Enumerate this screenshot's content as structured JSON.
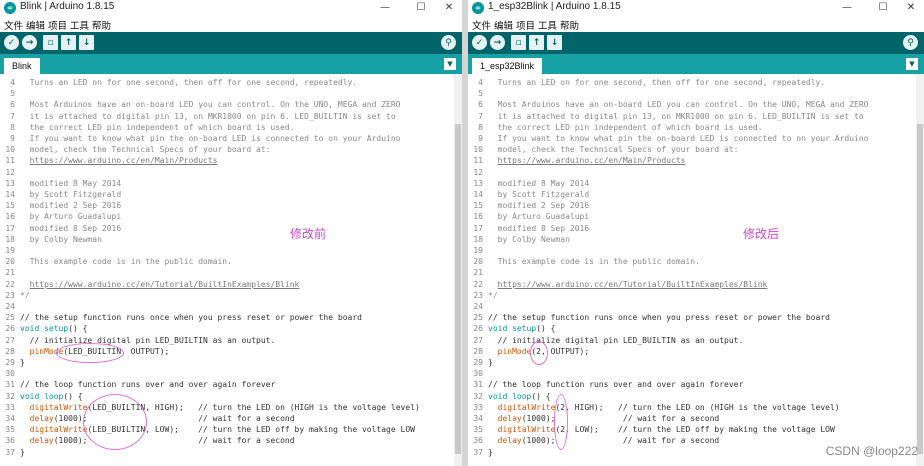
{
  "left": {
    "title": "Blink | Arduino 1.8.15",
    "tab": "Blink",
    "annotation": "修改前",
    "lines": [
      {
        "n": "4",
        "parts": [
          {
            "t": "  Turns an LED on for one second, then off for one second, repeatedly.",
            "c": "cm"
          }
        ]
      },
      {
        "n": "5",
        "parts": []
      },
      {
        "n": "6",
        "parts": [
          {
            "t": "  Most Arduinos have an on-board LED you can control. On the UNO, MEGA and ZERO",
            "c": "cm"
          }
        ]
      },
      {
        "n": "7",
        "parts": [
          {
            "t": "  it is attached to digital pin 13, on MKR1000 on pin 6. LED_BUILTIN is set to",
            "c": "cm"
          }
        ]
      },
      {
        "n": "8",
        "parts": [
          {
            "t": "  the correct LED pin independent of which board is used.",
            "c": "cm"
          }
        ]
      },
      {
        "n": "9",
        "parts": [
          {
            "t": "  If you want to know what pin the on-board LED is connected to on your Arduino",
            "c": "cm"
          }
        ]
      },
      {
        "n": "10",
        "parts": [
          {
            "t": "  model, check the Technical Specs of your board at:",
            "c": "cm"
          }
        ]
      },
      {
        "n": "11",
        "parts": [
          {
            "t": "  ",
            "c": "cm"
          },
          {
            "t": "https://www.arduino.cc/en/Main/Products",
            "c": "lk"
          }
        ]
      },
      {
        "n": "12",
        "parts": []
      },
      {
        "n": "13",
        "parts": [
          {
            "t": "  modified 8 May 2014",
            "c": "cm"
          }
        ]
      },
      {
        "n": "14",
        "parts": [
          {
            "t": "  by Scott Fitzgerald",
            "c": "cm"
          }
        ]
      },
      {
        "n": "15",
        "parts": [
          {
            "t": "  modified 2 Sep 2016",
            "c": "cm"
          }
        ]
      },
      {
        "n": "16",
        "parts": [
          {
            "t": "  by Arturo Guadalupi",
            "c": "cm"
          }
        ]
      },
      {
        "n": "17",
        "parts": [
          {
            "t": "  modified 8 Sep 2016",
            "c": "cm"
          }
        ]
      },
      {
        "n": "18",
        "parts": [
          {
            "t": "  by Colby Newman",
            "c": "cm"
          }
        ]
      },
      {
        "n": "19",
        "parts": []
      },
      {
        "n": "20",
        "parts": [
          {
            "t": "  This example code is in the public domain.",
            "c": "cm"
          }
        ]
      },
      {
        "n": "21",
        "parts": []
      },
      {
        "n": "22",
        "parts": [
          {
            "t": "  ",
            "c": "cm"
          },
          {
            "t": "https://www.arduino.cc/en/Tutorial/BuiltInExamples/Blink",
            "c": "lk"
          }
        ]
      },
      {
        "n": "23",
        "parts": [
          {
            "t": "*/",
            "c": "cm"
          }
        ]
      },
      {
        "n": "24",
        "parts": []
      },
      {
        "n": "25",
        "parts": [
          {
            "t": "// the setup function runs once when you press reset or power the board",
            "c": "tx"
          }
        ]
      },
      {
        "n": "26",
        "parts": [
          {
            "t": "void",
            "c": "kw"
          },
          {
            "t": " ",
            "c": "tx"
          },
          {
            "t": "setup",
            "c": "kw"
          },
          {
            "t": "() {",
            "c": "tx"
          }
        ]
      },
      {
        "n": "27",
        "parts": [
          {
            "t": "  // initialize digital pin LED_BUILTIN as an output.",
            "c": "tx"
          }
        ]
      },
      {
        "n": "28",
        "parts": [
          {
            "t": "  ",
            "c": "tx"
          },
          {
            "t": "pinMode",
            "c": "fn"
          },
          {
            "t": "(LED_BUILTIN, OUTPUT);",
            "c": "tx"
          }
        ]
      },
      {
        "n": "29",
        "parts": [
          {
            "t": "}",
            "c": "tx"
          }
        ]
      },
      {
        "n": "30",
        "parts": []
      },
      {
        "n": "31",
        "parts": [
          {
            "t": "// the loop function runs over and over again forever",
            "c": "tx"
          }
        ]
      },
      {
        "n": "32",
        "parts": [
          {
            "t": "void",
            "c": "kw"
          },
          {
            "t": " ",
            "c": "tx"
          },
          {
            "t": "loop",
            "c": "kw"
          },
          {
            "t": "() {",
            "c": "tx"
          }
        ]
      },
      {
        "n": "33",
        "parts": [
          {
            "t": "  ",
            "c": "tx"
          },
          {
            "t": "digitalWrite",
            "c": "fn"
          },
          {
            "t": "(LED_BUILTIN, HIGH);   // turn the LED on (HIGH is the voltage level)",
            "c": "tx"
          }
        ]
      },
      {
        "n": "34",
        "parts": [
          {
            "t": "  ",
            "c": "tx"
          },
          {
            "t": "delay",
            "c": "fn"
          },
          {
            "t": "(1000);                       // wait for a second",
            "c": "tx"
          }
        ]
      },
      {
        "n": "35",
        "parts": [
          {
            "t": "  ",
            "c": "tx"
          },
          {
            "t": "digitalWrite",
            "c": "fn"
          },
          {
            "t": "(LED_BUILTIN, LOW);    // turn the LED off by making the voltage LOW",
            "c": "tx"
          }
        ]
      },
      {
        "n": "36",
        "parts": [
          {
            "t": "  ",
            "c": "tx"
          },
          {
            "t": "delay",
            "c": "fn"
          },
          {
            "t": "(1000);                       // wait for a second",
            "c": "tx"
          }
        ]
      },
      {
        "n": "37",
        "parts": [
          {
            "t": "}",
            "c": "tx"
          }
        ]
      }
    ]
  },
  "right": {
    "title": "1_esp32Blink | Arduino 1.8.15",
    "tab": "1_esp32Blink",
    "annotation": "修改后",
    "lines": [
      {
        "n": "4",
        "parts": [
          {
            "t": "  Turns an LED on for one second, then off for one second, repeatedly.",
            "c": "cm"
          }
        ]
      },
      {
        "n": "5",
        "parts": []
      },
      {
        "n": "6",
        "parts": [
          {
            "t": "  Most Arduinos have an on-board LED you can control. On the UNO, MEGA and ZERO",
            "c": "cm"
          }
        ]
      },
      {
        "n": "7",
        "parts": [
          {
            "t": "  it is attached to digital pin 13, on MKR1000 on pin 6. LED_BUILTIN is set to",
            "c": "cm"
          }
        ]
      },
      {
        "n": "8",
        "parts": [
          {
            "t": "  the correct LED pin independent of which board is used.",
            "c": "cm"
          }
        ]
      },
      {
        "n": "9",
        "parts": [
          {
            "t": "  If you want to know what pin the on-board LED is connected to on your Arduino",
            "c": "cm"
          }
        ]
      },
      {
        "n": "10",
        "parts": [
          {
            "t": "  model, check the Technical Specs of your board at:",
            "c": "cm"
          }
        ]
      },
      {
        "n": "11",
        "parts": [
          {
            "t": "  ",
            "c": "cm"
          },
          {
            "t": "https://www.arduino.cc/en/Main/Products",
            "c": "lk"
          }
        ]
      },
      {
        "n": "12",
        "parts": []
      },
      {
        "n": "13",
        "parts": [
          {
            "t": "  modified 8 May 2014",
            "c": "cm"
          }
        ]
      },
      {
        "n": "14",
        "parts": [
          {
            "t": "  by Scott Fitzgerald",
            "c": "cm"
          }
        ]
      },
      {
        "n": "15",
        "parts": [
          {
            "t": "  modified 2 Sep 2016",
            "c": "cm"
          }
        ]
      },
      {
        "n": "16",
        "parts": [
          {
            "t": "  by Arturo Guadalupi",
            "c": "cm"
          }
        ]
      },
      {
        "n": "17",
        "parts": [
          {
            "t": "  modified 8 Sep 2016",
            "c": "cm"
          }
        ]
      },
      {
        "n": "18",
        "parts": [
          {
            "t": "  by Colby Newman",
            "c": "cm"
          }
        ]
      },
      {
        "n": "19",
        "parts": []
      },
      {
        "n": "20",
        "parts": [
          {
            "t": "  This example code is in the public domain.",
            "c": "cm"
          }
        ]
      },
      {
        "n": "21",
        "parts": []
      },
      {
        "n": "22",
        "parts": [
          {
            "t": "  ",
            "c": "cm"
          },
          {
            "t": "https://www.arduino.cc/en/Tutorial/BuiltInExamples/Blink",
            "c": "lk"
          }
        ]
      },
      {
        "n": "23",
        "parts": [
          {
            "t": "*/",
            "c": "cm"
          }
        ]
      },
      {
        "n": "24",
        "parts": []
      },
      {
        "n": "25",
        "parts": [
          {
            "t": "// the setup function runs once when you press reset or power the board",
            "c": "tx"
          }
        ]
      },
      {
        "n": "26",
        "parts": [
          {
            "t": "void",
            "c": "kw"
          },
          {
            "t": " ",
            "c": "tx"
          },
          {
            "t": "setup",
            "c": "kw"
          },
          {
            "t": "() {",
            "c": "tx"
          }
        ]
      },
      {
        "n": "27",
        "parts": [
          {
            "t": "  // initialize digital pin LED_BUILTIN as an output.",
            "c": "tx"
          }
        ]
      },
      {
        "n": "28",
        "parts": [
          {
            "t": "  ",
            "c": "tx"
          },
          {
            "t": "pinMode",
            "c": "fn"
          },
          {
            "t": "(2, OUTPUT);",
            "c": "tx"
          }
        ]
      },
      {
        "n": "29",
        "parts": [
          {
            "t": "}",
            "c": "tx"
          }
        ]
      },
      {
        "n": "30",
        "parts": []
      },
      {
        "n": "31",
        "parts": [
          {
            "t": "// the loop function runs over and over again forever",
            "c": "tx"
          }
        ]
      },
      {
        "n": "32",
        "parts": [
          {
            "t": "void",
            "c": "kw"
          },
          {
            "t": " ",
            "c": "tx"
          },
          {
            "t": "loop",
            "c": "kw"
          },
          {
            "t": "() {",
            "c": "tx"
          }
        ]
      },
      {
        "n": "33",
        "parts": [
          {
            "t": "  ",
            "c": "tx"
          },
          {
            "t": "digitalWrite",
            "c": "fn"
          },
          {
            "t": "(2, HIGH);   // turn the LED on (HIGH is the voltage level)",
            "c": "tx"
          }
        ]
      },
      {
        "n": "34",
        "parts": [
          {
            "t": "  ",
            "c": "tx"
          },
          {
            "t": "delay",
            "c": "fn"
          },
          {
            "t": "(1000);              // wait for a second",
            "c": "tx"
          }
        ]
      },
      {
        "n": "35",
        "parts": [
          {
            "t": "  ",
            "c": "tx"
          },
          {
            "t": "digitalWrite",
            "c": "fn"
          },
          {
            "t": "(2, LOW);    // turn the LED off by making the voltage LOW",
            "c": "tx"
          }
        ]
      },
      {
        "n": "36",
        "parts": [
          {
            "t": "  ",
            "c": "tx"
          },
          {
            "t": "delay",
            "c": "fn"
          },
          {
            "t": "(1000);              // wait for a second",
            "c": "tx"
          }
        ]
      },
      {
        "n": "37",
        "parts": [
          {
            "t": "}",
            "c": "tx"
          }
        ]
      }
    ]
  },
  "menu": [
    "文件",
    "编辑",
    "项目",
    "工具",
    "帮助"
  ],
  "window_controls": [
    "—",
    "☐",
    "✕"
  ],
  "icons": {
    "app": "∞",
    "verify": "✓",
    "upload": "→",
    "new": "▫",
    "open": "↑",
    "save": "↓",
    "serial_monitor": "⚲",
    "tab_menu": "▼"
  },
  "watermark": "CSDN @loop222",
  "colors": {
    "toolbar": "#006468",
    "tabbar": "#17a1a5",
    "keyword": "#00979d",
    "function": "#d35400",
    "annotation": "#c94ac9"
  }
}
